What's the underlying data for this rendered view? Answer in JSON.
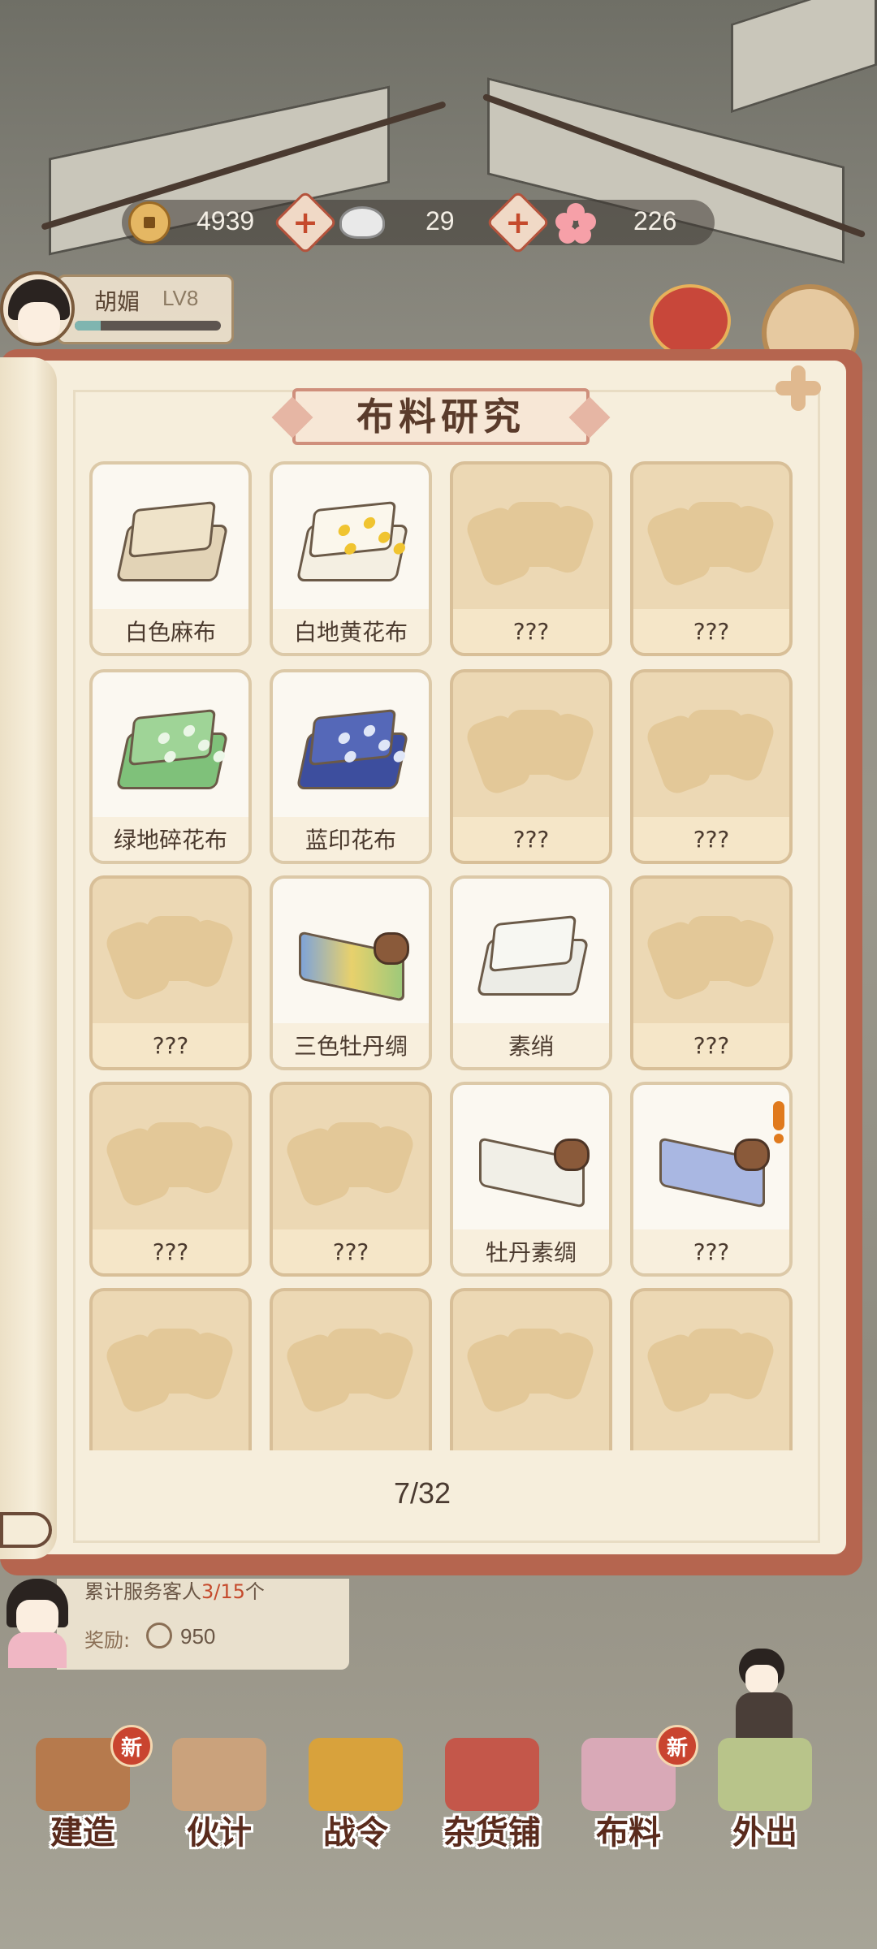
{
  "resources": {
    "copper": "4939",
    "silver": "29",
    "flower": "226"
  },
  "player": {
    "name": "胡媚",
    "level": "LV8",
    "xp_fraction": 0.18
  },
  "panel": {
    "title": "布料研究",
    "page_indicator": "7/32"
  },
  "fabrics": [
    {
      "name": "白色麻布",
      "known": true,
      "kind": "linen"
    },
    {
      "name": "白地黄花布",
      "known": true,
      "kind": "yellowflower"
    },
    {
      "name": "???",
      "known": false
    },
    {
      "name": "???",
      "known": false
    },
    {
      "name": "绿地碎花布",
      "known": true,
      "kind": "green"
    },
    {
      "name": "蓝印花布",
      "known": true,
      "kind": "blue"
    },
    {
      "name": "???",
      "known": false
    },
    {
      "name": "???",
      "known": false
    },
    {
      "name": "???",
      "known": false
    },
    {
      "name": "三色牡丹绸",
      "known": true,
      "kind": "tricolor"
    },
    {
      "name": "素绡",
      "known": true,
      "kind": "plain"
    },
    {
      "name": "???",
      "known": false
    },
    {
      "name": "???",
      "known": false
    },
    {
      "name": "???",
      "known": false
    },
    {
      "name": "牡丹素绸",
      "known": true,
      "kind": "peonywhite"
    },
    {
      "name": "???",
      "known": true,
      "kind": "peonyblue",
      "alert": true
    },
    {
      "name": "",
      "known": false
    },
    {
      "name": "",
      "known": false
    },
    {
      "name": "",
      "known": false
    },
    {
      "name": "",
      "known": false
    }
  ],
  "service": {
    "progress_label": "累计服务客人",
    "progress_value": "3/15",
    "progress_suffix": "个",
    "reward_label": "奖励:",
    "reward_value": "950"
  },
  "nav": [
    {
      "label": "建造",
      "badge": "新",
      "color": "#b67a4d"
    },
    {
      "label": "伙计",
      "badge": "",
      "color": "#caa27c"
    },
    {
      "label": "战令",
      "badge": "",
      "color": "#d8a23c"
    },
    {
      "label": "杂货铺",
      "badge": "",
      "color": "#c4574a"
    },
    {
      "label": "布料",
      "badge": "新",
      "color": "#d9a9b7"
    },
    {
      "label": "外出",
      "badge": "",
      "color": "#b8c48a"
    }
  ],
  "colors": {
    "book_cover": "#b5654f",
    "page": "#f6eedc",
    "locked_card": "#ecd8b4",
    "alert": "#e07a1d"
  }
}
